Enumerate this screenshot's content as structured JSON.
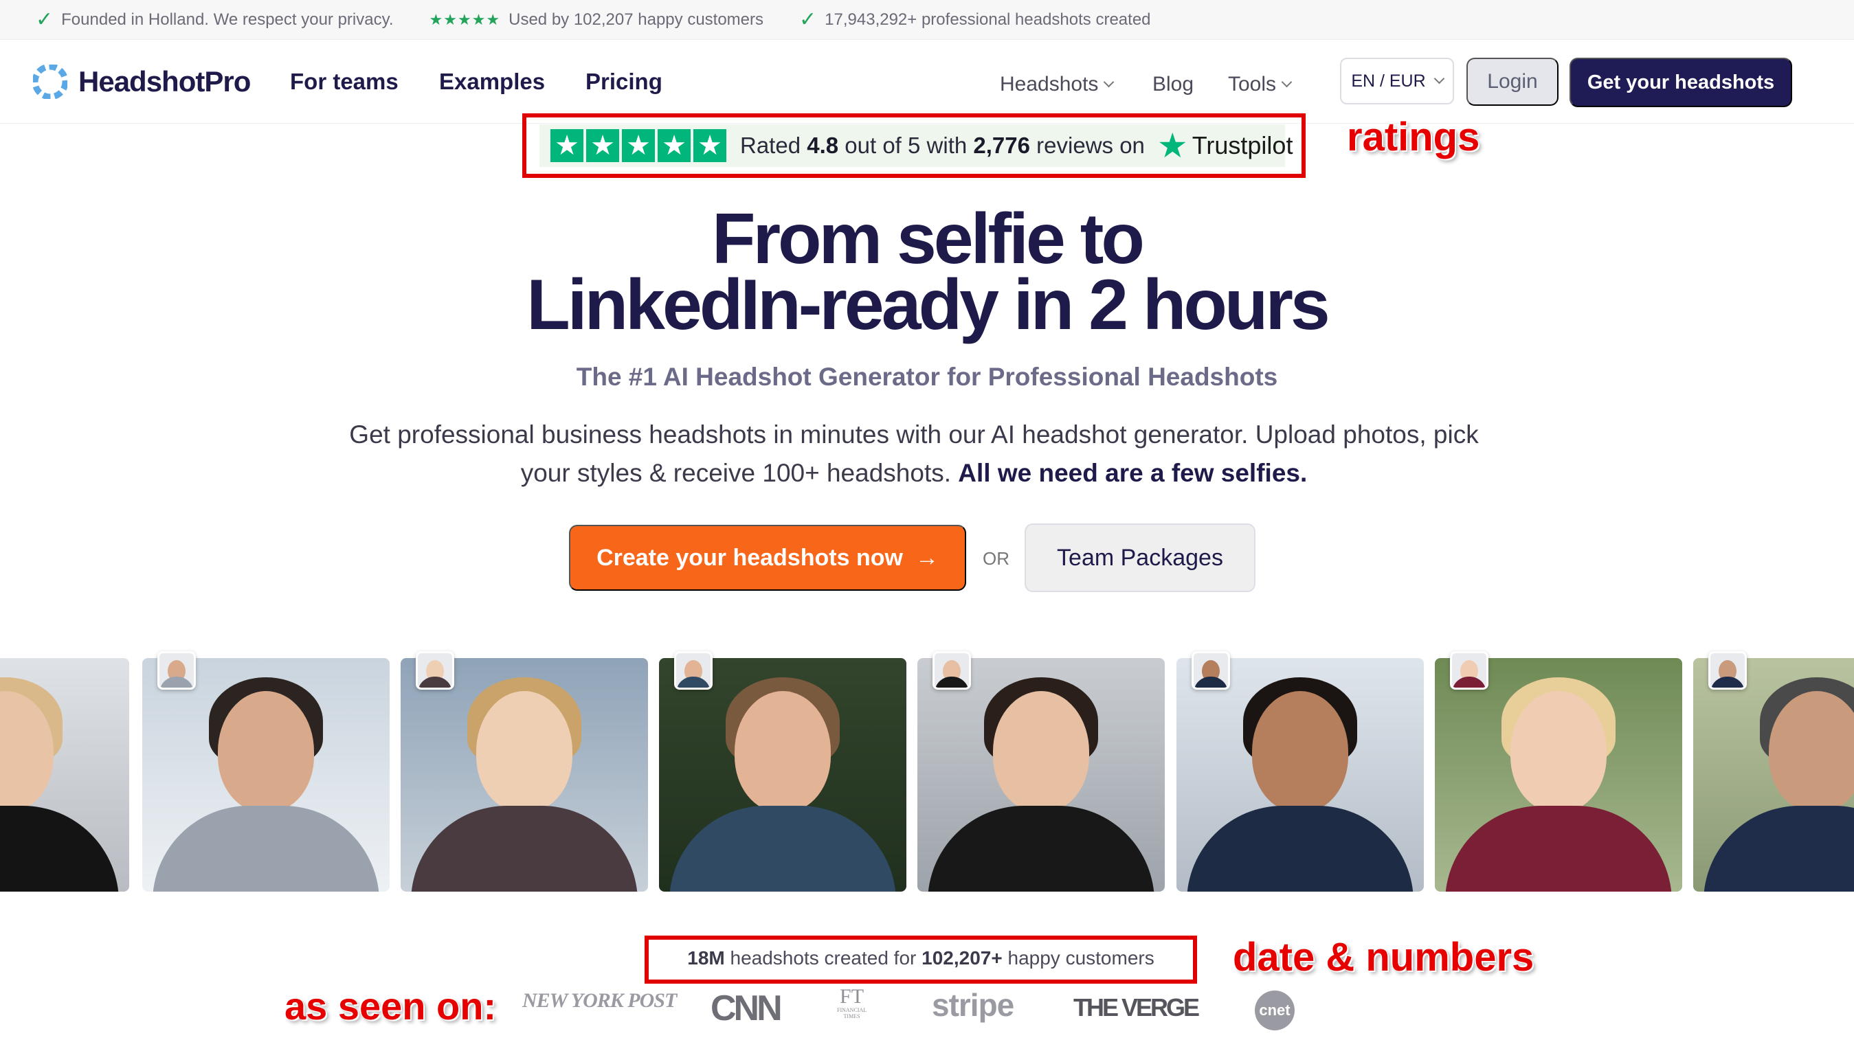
{
  "topbar": {
    "items": [
      {
        "text": "Founded in Holland. We respect your privacy."
      },
      {
        "text": "Used by 102,207 happy customers",
        "stars": "★★★★★"
      },
      {
        "text": "17,943,292+ professional headshots created"
      }
    ]
  },
  "nav": {
    "brand": "HeadshotPro",
    "links": [
      "For teams",
      "Examples",
      "Pricing"
    ],
    "right_links": [
      "Headshots",
      "Blog",
      "Tools"
    ],
    "language": "EN / EUR",
    "login": "Login",
    "cta": "Get your headshots"
  },
  "trustpilot": {
    "prefix": "Rated",
    "rating": "4.8",
    "mid": "out of 5 with",
    "reviews": "2,776",
    "suffix": "reviews on",
    "brand": "Trustpilot",
    "star_glyph": "★"
  },
  "annotations": {
    "ratings": "ratings",
    "numbers": "date & numbers",
    "seen_on": "as seen on:"
  },
  "hero": {
    "title_line1": "From selfie to",
    "title_line2": "LinkedIn-ready in 2 hours",
    "subtitle": "The #1 AI Headshot Generator for Professional Headshots",
    "desc_plain": "Get professional business headshots in minutes with our AI headshot generator. Upload photos, pick your styles & receive 100+ headshots.",
    "desc_bold": "All we need are a few selfies.",
    "cta_primary": "Create your headshots now",
    "cta_arrow": "→",
    "or": "OR",
    "cta_secondary": "Team Packages"
  },
  "stats": {
    "count_bold": "18M",
    "text1": "headshots created for",
    "customers_bold": "102,207+",
    "text2": "happy customers"
  },
  "press": {
    "nyp": "NEW YORK POST",
    "cnn": "CNN",
    "ft_big": "FT",
    "ft_small1": "FINANCIAL",
    "ft_small2": "TIMES",
    "stripe": "stripe",
    "verge": "THE VERGE",
    "cnet": "cnet"
  },
  "colors": {
    "navy": "#1e1b4b",
    "orange": "#f8661a",
    "trustpilot_green": "#00b67a",
    "annotation_red": "#e00000"
  }
}
